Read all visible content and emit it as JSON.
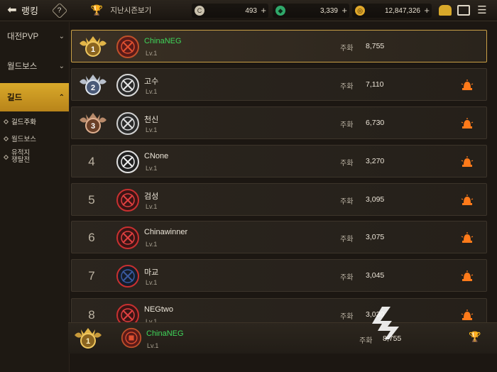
{
  "header": {
    "back_icon": "arrow-left-icon",
    "title": "랭킹",
    "help_label": "?",
    "season_label": "지난시즌보기",
    "currency_1": "493",
    "currency_2": "3,339",
    "currency_3": "12,847,326",
    "plus": "+"
  },
  "sidebar": {
    "items": [
      {
        "label": "대전PVP"
      },
      {
        "label": "월드보스"
      },
      {
        "label": "길드"
      }
    ],
    "subitems": [
      {
        "label": "길드주화"
      },
      {
        "label": "월드보스"
      },
      {
        "label_line1": "유적지",
        "label_line2": "쟁탈전"
      }
    ]
  },
  "rows": [
    {
      "rank": "1",
      "name": "ChinaNEG",
      "level": "Lv.1",
      "stat_label": "주화",
      "value": "8,755"
    },
    {
      "rank": "2",
      "name": "고수",
      "level": "Lv.1",
      "stat_label": "주화",
      "value": "7,110"
    },
    {
      "rank": "3",
      "name": "천신",
      "level": "Lv.1",
      "stat_label": "주화",
      "value": "6,730"
    },
    {
      "rank": "4",
      "name": "CNone",
      "level": "Lv.1",
      "stat_label": "주화",
      "value": "3,270"
    },
    {
      "rank": "5",
      "name": "검성",
      "level": "Lv.1",
      "stat_label": "주화",
      "value": "3,095"
    },
    {
      "rank": "6",
      "name": "Chinawinner",
      "level": "Lv.1",
      "stat_label": "주화",
      "value": "3,075"
    },
    {
      "rank": "7",
      "name": "마교",
      "level": "Lv.1",
      "stat_label": "주화",
      "value": "3,045"
    },
    {
      "rank": "8",
      "name": "NEGtwo",
      "level": "Lv.1",
      "stat_label": "주화",
      "value": "3,030"
    }
  ],
  "my_guild": {
    "rank": "1",
    "name": "ChinaNEG",
    "level": "Lv.1",
    "stat_label": "주화",
    "value": "8,755"
  },
  "watermark": "九游",
  "colors": {
    "accent": "#d9a92a",
    "mine_name": "#3fd65a",
    "alarm": "#ff7a1a"
  }
}
